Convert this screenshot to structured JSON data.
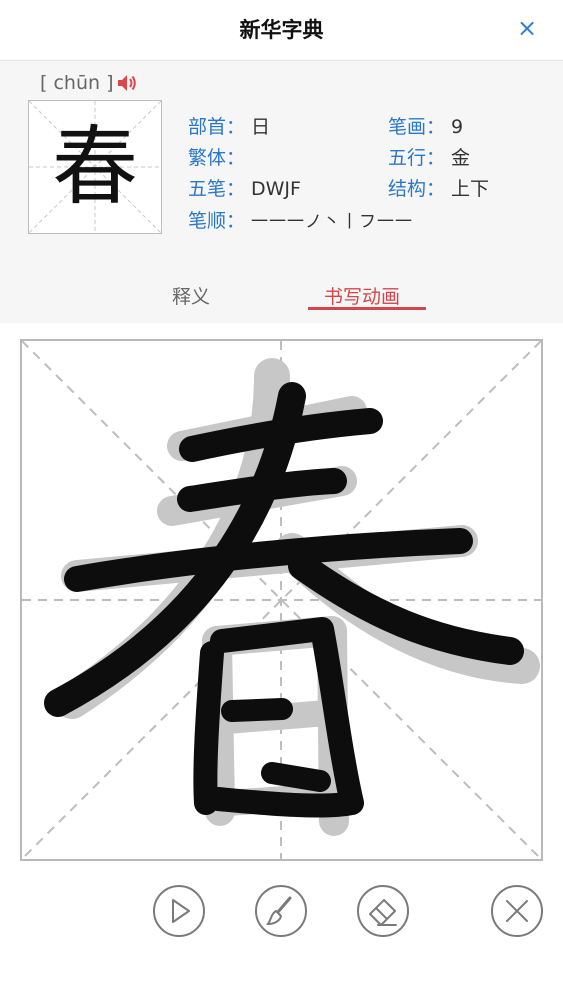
{
  "titlebar": {
    "title": "新华字典",
    "close_glyph": "×"
  },
  "character": {
    "char": "春",
    "pinyin": "[ chūn ]",
    "speaker_icon": "speaker-icon",
    "speaker_color": "#d9464c"
  },
  "info": {
    "radical_label": "部首：",
    "radical_value": "日",
    "strokes_label": "笔画：",
    "strokes_value": "9",
    "traditional_label": "繁体：",
    "traditional_value": "",
    "element_label": "五行：",
    "element_value": "金",
    "wubi_label": "五笔：",
    "wubi_value": "DWJF",
    "structure_label": "结构：",
    "structure_value": "上下",
    "order_label": "笔顺：",
    "order_value": "一一一ノ丶丨フ一一"
  },
  "tabs": [
    {
      "label": "释义",
      "active": false
    },
    {
      "label": "书写动画",
      "active": true
    }
  ],
  "controls": [
    {
      "icon": "play-icon"
    },
    {
      "icon": "brush-icon"
    },
    {
      "icon": "eraser-icon"
    },
    {
      "icon": "clear-icon"
    }
  ],
  "colors": {
    "accent_blue": "#2b78c8",
    "accent_red": "#d4464c",
    "label_gray": "#666666"
  }
}
